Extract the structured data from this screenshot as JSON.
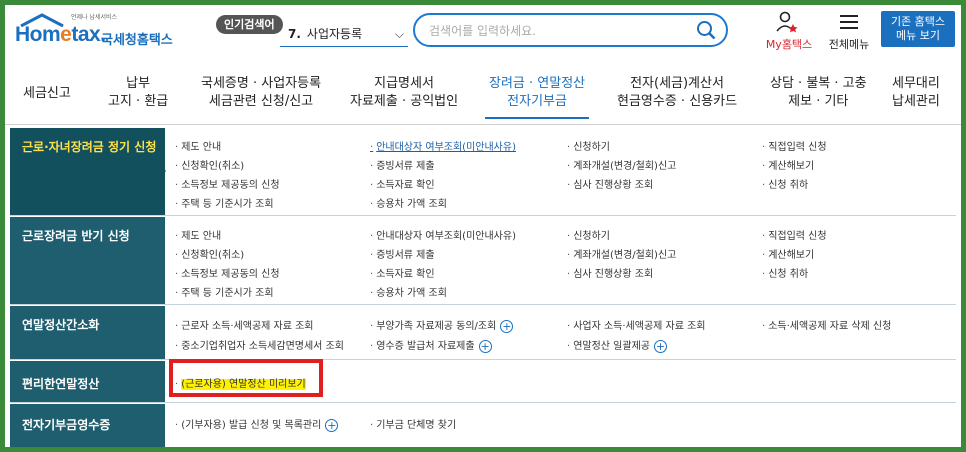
{
  "header": {
    "logo_tag": "언제나 납세서비스",
    "logo_home": "Hom",
    "logo_e": "e",
    "logo_tax": "tax.",
    "logo_kr": "국세청홈택스",
    "hot_label": "인기검색어",
    "hot_num": "7.",
    "hot_value": "사업자등록",
    "search_placeholder": "검색어를 입력하세요.",
    "my_label": "My홈택스",
    "menu_label": "전체메뉴",
    "old_button_line1": "기존 홈택스",
    "old_button_line2": "메뉴 보기"
  },
  "nav": [
    {
      "l1": "세금신고",
      "l2": ""
    },
    {
      "l1": "납부",
      "l2": "고지 · 환급"
    },
    {
      "l1": "국세증명 · 사업자등록",
      "l2": "세금관련 신청/신고"
    },
    {
      "l1": "지급명세서",
      "l2": "자료제출 · 공익법인"
    },
    {
      "l1": "장려금 · 연말정산",
      "l2": "전자기부금"
    },
    {
      "l1": "전자(세금)계산서",
      "l2": "현금영수증 · 신용카드"
    },
    {
      "l1": "상담 · 불복 · 고충",
      "l2": "제보 · 기타"
    },
    {
      "l1": "세무대리",
      "l2": "납세관리"
    }
  ],
  "sections": {
    "regular": {
      "title": "근로·자녀장려금 정기 신청",
      "c1": [
        "제도 안내",
        "신청확인(취소)",
        "소득정보 제공동의 신청",
        "주택 등 기준시가 조회"
      ],
      "c2": [
        "안내대상자 여부조회(미안내사유)",
        "증빙서류 제출",
        "소득자료 확인",
        "승용차 가액 조회"
      ],
      "c3": [
        "신청하기",
        "계좌개설(변경/철회)신고",
        "심사 진행상황 조회"
      ],
      "c4": [
        "직접입력 신청",
        "계산해보기",
        "신청 취하"
      ]
    },
    "half": {
      "title": "근로장려금 반기 신청",
      "c1": [
        "제도 안내",
        "신청확인(취소)",
        "소득정보 제공동의 신청",
        "주택 등 기준시가 조회"
      ],
      "c2": [
        "안내대상자 여부조회(미안내사유)",
        "증빙서류 제출",
        "소득자료 확인",
        "승용차 가액 조회"
      ],
      "c3": [
        "신청하기",
        "계좌개설(변경/철회)신고",
        "심사 진행상황 조회"
      ],
      "c4": [
        "직접입력 신청",
        "계산해보기",
        "신청 취하"
      ]
    },
    "simple": {
      "title": "연말정산간소화",
      "c1": [
        "근로자 소득·세액공제 자료 조회",
        "중소기업취업자 소득세감면명세서 조회"
      ],
      "c2": [
        "부양가족 자료제공 동의/조회",
        "영수증 발급처 자료제출"
      ],
      "c3": [
        "사업자 소득·세액공제 자료 조회",
        "연말정산 일괄제공"
      ],
      "c4": [
        "소득·세액공제 자료 삭제 신청"
      ]
    },
    "easy": {
      "title": "편리한연말정산",
      "c1": [
        "(근로자용) 연말정산 미리보기"
      ]
    },
    "donation": {
      "title": "전자기부금영수증",
      "c1": [
        "(기부자용) 발급 신청 및 목록관리"
      ],
      "c2": [
        "기부금 단체명 찾기"
      ]
    }
  }
}
